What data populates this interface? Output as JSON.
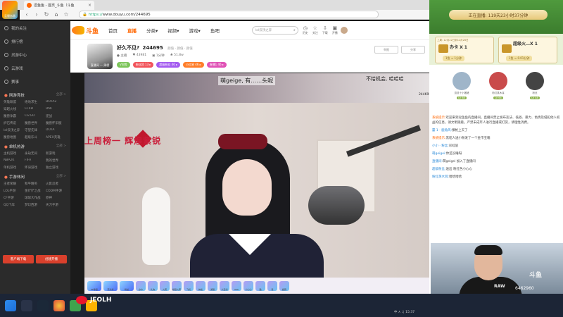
{
  "browser": {
    "logo_label": "云服务器",
    "tab_title": "逗鱼鱼 - 首页_斗鱼（斗鱼",
    "url_scheme": "https://",
    "url_host": "www.douyu.com",
    "url_path": "/244695"
  },
  "sidebar": {
    "top_items": [
      {
        "label": "我的关注",
        "icon": "heart-icon"
      },
      {
        "label": "排行榜",
        "icon": "trophy-icon"
      },
      {
        "label": "灵游中心",
        "icon": "gamepad-icon"
      },
      {
        "label": "云游戏",
        "icon": "cloud-icon"
      },
      {
        "label": "赛事",
        "icon": "cup-icon"
      }
    ],
    "sections": [
      {
        "title": "网游竞技",
        "all": "全部 >",
        "items": [
          "英雄联盟",
          "绝地求生",
          "DOTA2",
          "穿越火线",
          "CF4D",
          "DNF",
          "魔兽争霸",
          "CS:GO",
          "逆战",
          "炉石传说",
          "魔兽世界",
          "魔兽怀旧服",
          "lol云顶之弈",
          "守望先锋",
          "DOTA",
          "魔兽地图",
          "超级乐斗",
          "APEX英雄"
        ]
      },
      {
        "title": "单机热游",
        "all": "全部 >",
        "items": [
          "主机游戏",
          "永劫无间",
          "新游戏",
          "NBA2K",
          "FIFA",
          "我的世界",
          "单机游戏",
          "怀旧游戏",
          "独立游戏"
        ]
      },
      {
        "title": "手游休闲",
        "all": "全部 >",
        "items": [
          "王者荣耀",
          "和平精英",
          "火影忍者",
          "LOL手游",
          "金铲铲之战",
          "CODM手游",
          "CF手游",
          "球球大作战",
          "原神",
          "QQ飞车",
          "梦幻西游",
          "天刀手游"
        ]
      }
    ],
    "buttons": [
      "客户端下载",
      "创建开播"
    ]
  },
  "header": {
    "brand": "斗鱼",
    "nav": [
      "首页",
      "直播",
      "分类▾",
      "视频▾",
      "游戏▾",
      "鱼吧"
    ],
    "active_nav": "直播",
    "search_placeholder": "lol云顶之弈",
    "icons": [
      {
        "label": "历史",
        "icon": "clock-icon"
      },
      {
        "label": "关注",
        "icon": "star-icon"
      },
      {
        "label": "下载",
        "icon": "download-icon"
      },
      {
        "label": "开播",
        "icon": "camera-icon"
      }
    ]
  },
  "room": {
    "avatar_label": "直播间 一 周榜",
    "title": "好久不见?",
    "room_id": "244695",
    "tag": "颜值 · 颜值 · 颜值",
    "meta": [
      "● 主播",
      "♥ 43981",
      "▣ 1分钟",
      "♣ 51.8w"
    ],
    "badges": [
      {
        "text": "V同等",
        "color": "#7cc55a"
      },
      {
        "text": "粉丝团 13 ▸",
        "color": "#f2545b"
      },
      {
        "text": "超级粉丝 46 ▸",
        "color": "#a45cf0"
      },
      {
        "text": "小红星 46 ▸",
        "color": "#ff7e2a"
      },
      {
        "text": "直播1 46 ▸",
        "color": "#e053b6"
      }
    ],
    "report": "举报",
    "share": "分享"
  },
  "video": {
    "caption_top": "萌geige, 有……头呢",
    "caption_right": "不给机会, 哈哈哈",
    "room_no": "244695",
    "banner": "上周榜一 辉煌紫锐"
  },
  "gifts": [
    "PK等级",
    "荧光棒",
    "粉丝",
    "办卡",
    "礼物",
    "火箭",
    "超级火箭",
    "飞机",
    "神龙",
    "游艇",
    "大宝剑",
    "666",
    "小心心",
    "酷",
    "赞",
    "超跑"
  ],
  "right_panel": {
    "live_time": "正在直播: 119天23小时37分钟",
    "treasures": [
      {
        "date": "上周: 12月22日到12月28日",
        "name": "办卡 X 1",
        "price": "1鱼 = 1分钟"
      },
      {
        "date": "",
        "name": "超级火…X 1",
        "price": "1鱼 = 0.01分钟"
      }
    ],
    "fans": [
      {
        "name": "逗逗十小猪猪",
        "level": "LV 68",
        "color": "#9fb5c9"
      },
      {
        "name": "粉红蒸木耳",
        "level": "LV 64",
        "color": "#c94b4b"
      },
      {
        "name": "粉丝",
        "level": "LV 48",
        "color": "#444"
      }
    ],
    "chat": [
      {
        "sys": "系统提示:",
        "text": "欢迎来到逗鱼鱼的直播间。直播间禁止发布违法、低俗、暴力、色情及侵犯他人权益的信息，请文明观看。严禁未成年人进行直播或打赏，请理性消费。"
      },
      {
        "user": "霸 1 · 鹿角风:",
        "text": "擦枪上天了"
      },
      {
        "sys": "系统提示:",
        "text": "黑貂人送小粉发了一个金币宝箱"
      },
      {
        "user": "小小 · 粉丝:",
        "text": "彩虹屁"
      },
      {
        "user": "萌geigei:",
        "text": "你还没睡呀"
      },
      {
        "user": "直播间:",
        "text": "萌geigei 加入了直播间"
      },
      {
        "user": "超级粉丝:",
        "text": "送出 粉红色小心心"
      },
      {
        "user": "粉红蒸木耳:",
        "text": "哈哈哈哈"
      }
    ]
  },
  "webcam": {
    "shirt_text": "RAW",
    "number": "6462960",
    "logo": "斗鱼"
  },
  "watermark": "JEOLH",
  "taskbar": {
    "tray": "中  ∧  ♫  15:37"
  }
}
